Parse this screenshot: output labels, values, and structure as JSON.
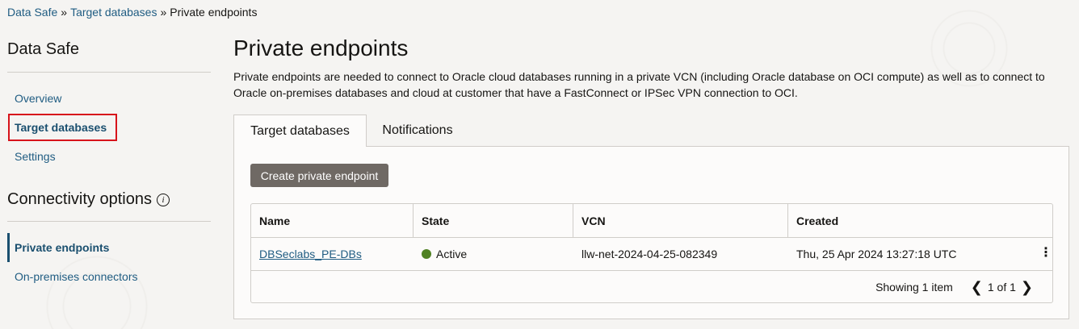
{
  "breadcrumb": {
    "items": [
      "Data Safe",
      "Target databases",
      "Private endpoints"
    ],
    "separator": "»"
  },
  "sidebar": {
    "title": "Data Safe",
    "items": [
      "Overview",
      "Target databases",
      "Settings"
    ],
    "section_title": "Connectivity options",
    "section_items": [
      "Private endpoints",
      "On-premises connectors"
    ],
    "info_icon": "i"
  },
  "main": {
    "title": "Private endpoints",
    "description": "Private endpoints are needed to connect to Oracle cloud databases running in a private VCN (including Oracle database on OCI compute) as well as to connect to Oracle on-premises databases and cloud at customer that have a FastConnect or IPSec VPN connection to OCI.",
    "tabs": [
      "Target databases",
      "Notifications"
    ],
    "create_button": "Create private endpoint"
  },
  "table": {
    "columns": [
      "Name",
      "State",
      "VCN",
      "Created"
    ],
    "rows": [
      {
        "name": "DBSeclabs_PE-DBs",
        "state": "Active",
        "vcn": "llw-net-2024-04-25-082349",
        "created": "Thu, 25 Apr 2024 13:27:18 UTC",
        "menu": "⋮"
      }
    ],
    "showing": "Showing 1 item",
    "page": "1 of 1",
    "prev": "❮",
    "next": "❯"
  },
  "colors": {
    "link": "#1f5c82",
    "active_state": "#508223",
    "highlight": "#d7131b",
    "button_bg": "#6f6964"
  }
}
